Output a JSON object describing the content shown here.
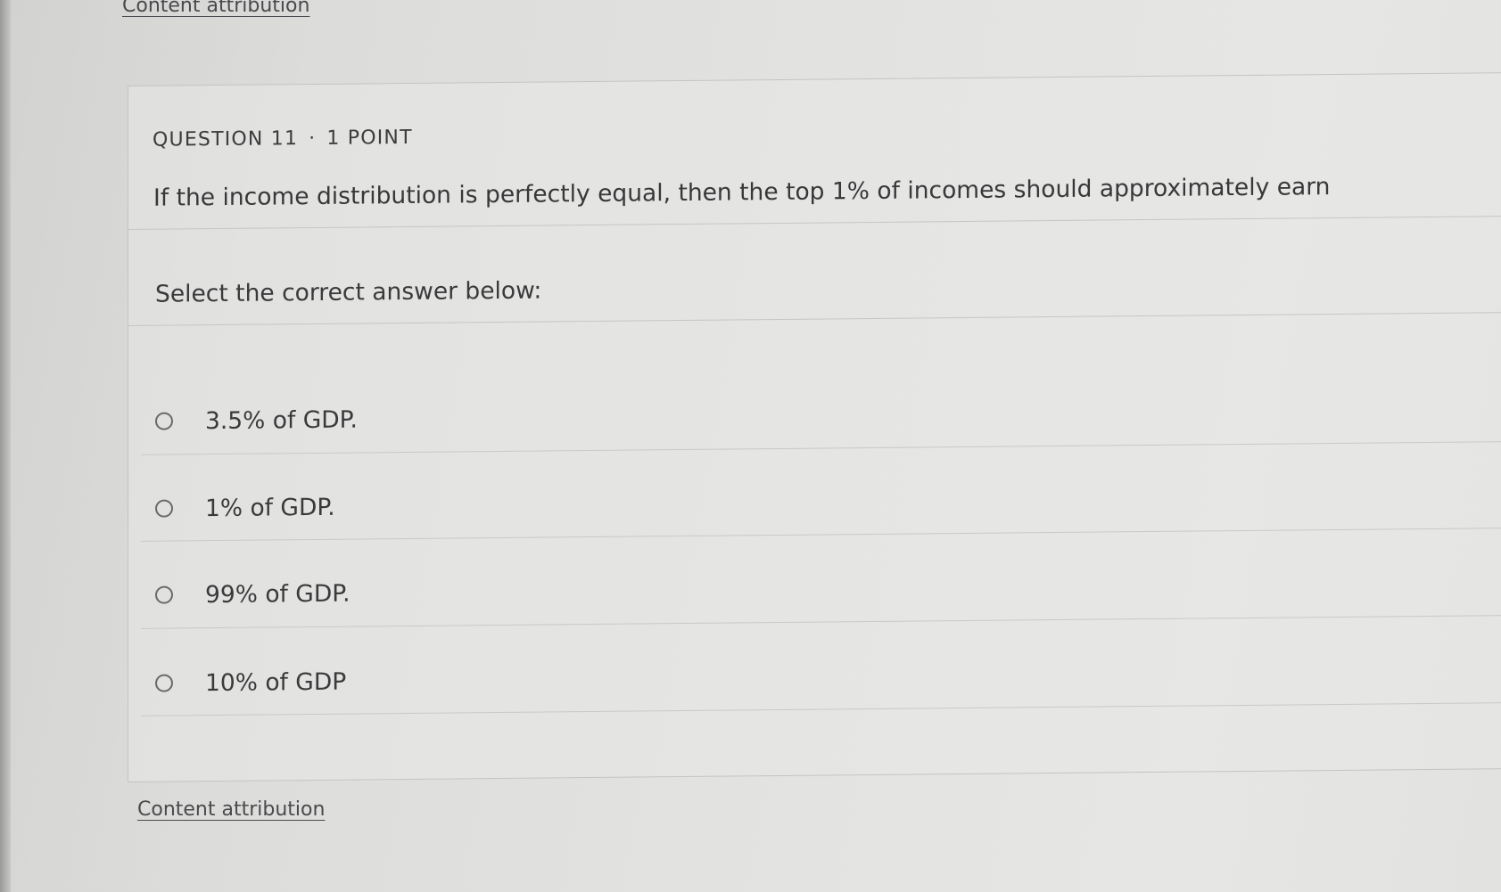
{
  "links": {
    "content_attribution_top": "Content attribution",
    "content_attribution_bottom": "Content attribution"
  },
  "question": {
    "number_label": "QUESTION 11",
    "separator": "·",
    "points_label": "1 POINT",
    "text": "If the income distribution is perfectly equal, then the top 1% of incomes should approximately earn",
    "prompt": "Select the correct answer below:",
    "options": [
      {
        "label": "3.5% of GDP.",
        "selected": false
      },
      {
        "label": "1% of GDP.",
        "selected": false
      },
      {
        "label": "99% of GDP.",
        "selected": false
      },
      {
        "label": "10% of GDP",
        "selected": false
      }
    ]
  }
}
